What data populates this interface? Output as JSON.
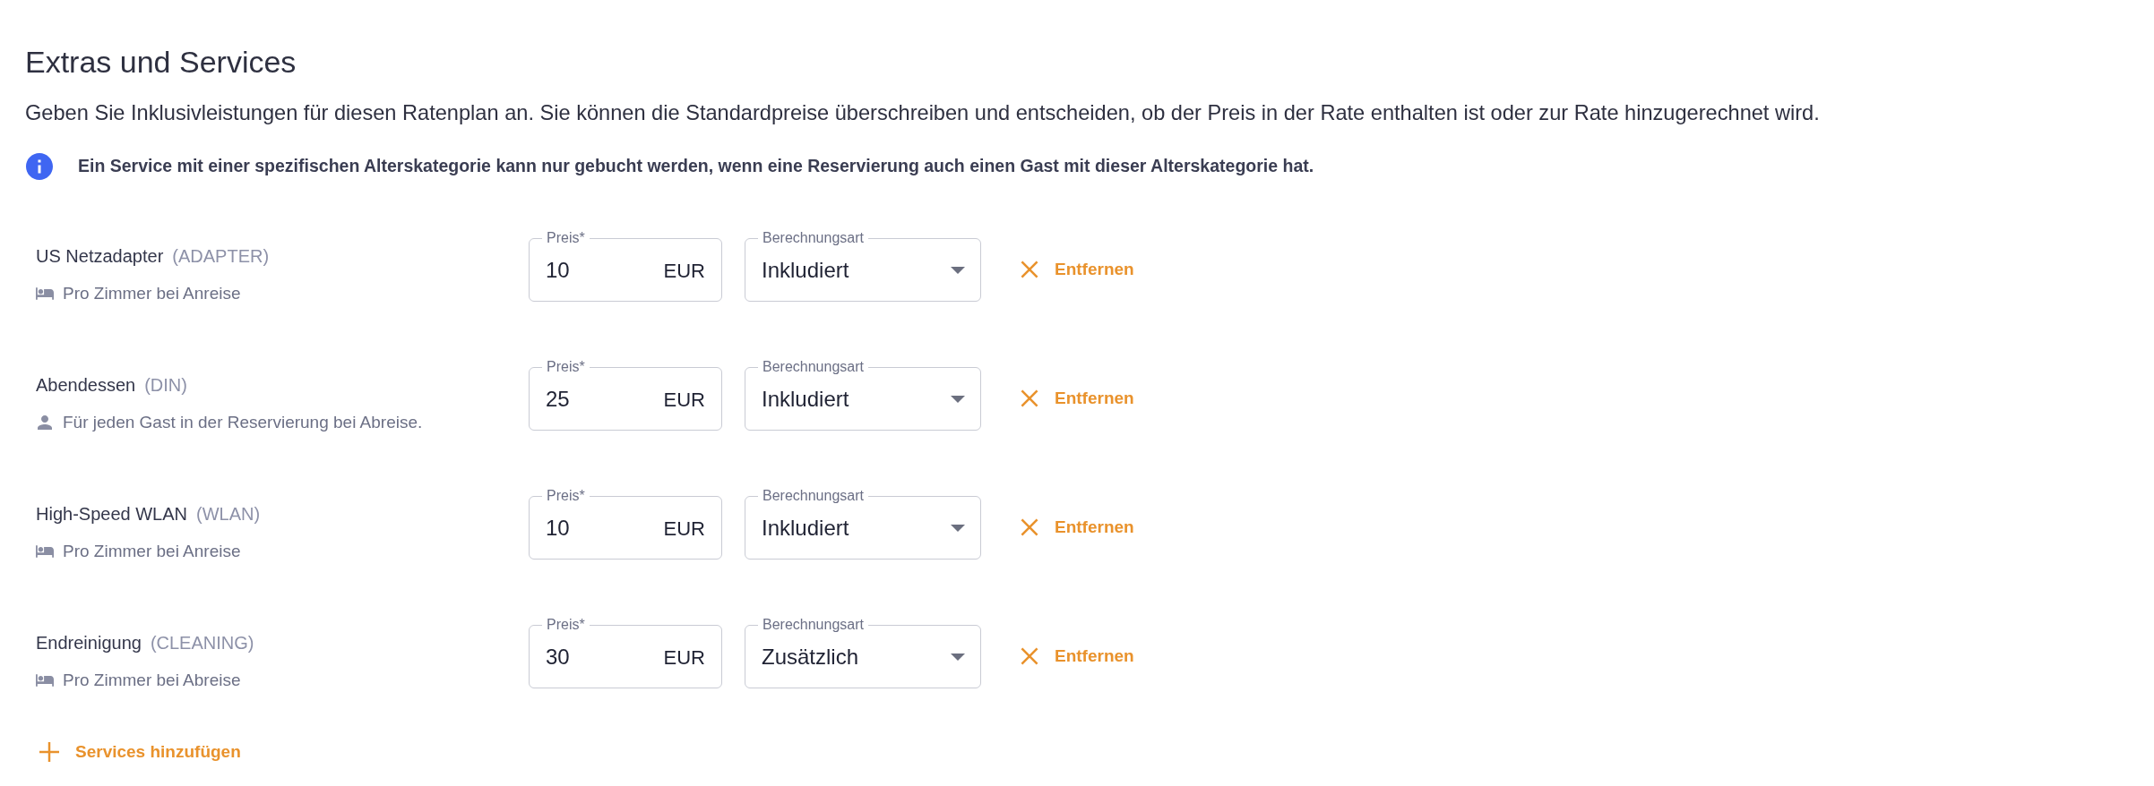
{
  "title": "Extras und Services",
  "description": "Geben Sie Inklusivleistungen für diesen Ratenplan an. Sie können die Standardpreise überschreiben und entscheiden, ob der Preis in der Rate enthalten ist oder zur Rate hinzugerechnet wird.",
  "notice": {
    "text": "Ein Service mit einer spezifischen Alterskategorie kann nur gebucht werden, wenn eine Reservierung auch einen Gast mit dieser Alterskategorie hat."
  },
  "services": [
    {
      "name": "US Netzadapter",
      "code": "(ADAPTER)",
      "kind": "room",
      "unit": "Pro Zimmer bei Anreise",
      "price": {
        "label": "Preis*",
        "value": "10",
        "currency": "EUR"
      },
      "calculation": {
        "label": "Berechnungsart",
        "value": "Inkludiert"
      },
      "remove_label": "Entfernen"
    },
    {
      "name": "Abendessen",
      "code": "(DIN)",
      "kind": "person",
      "unit": "Für jeden Gast in der Reservierung bei Abreise.",
      "price": {
        "label": "Preis*",
        "value": "25",
        "currency": "EUR"
      },
      "calculation": {
        "label": "Berechnungsart",
        "value": "Inkludiert"
      },
      "remove_label": "Entfernen"
    },
    {
      "name": "High-Speed WLAN",
      "code": "(WLAN)",
      "kind": "room",
      "unit": "Pro Zimmer bei Anreise",
      "price": {
        "label": "Preis*",
        "value": "10",
        "currency": "EUR"
      },
      "calculation": {
        "label": "Berechnungsart",
        "value": "Inkludiert"
      },
      "remove_label": "Entfernen"
    },
    {
      "name": "Endreinigung",
      "code": "(CLEANING)",
      "kind": "room",
      "unit": "Pro Zimmer bei Abreise",
      "price": {
        "label": "Preis*",
        "value": "30",
        "currency": "EUR"
      },
      "calculation": {
        "label": "Berechnungsart",
        "value": "Zusätzlich"
      },
      "remove_label": "Entfernen"
    }
  ],
  "add_button": {
    "label": "Services hinzufügen"
  }
}
